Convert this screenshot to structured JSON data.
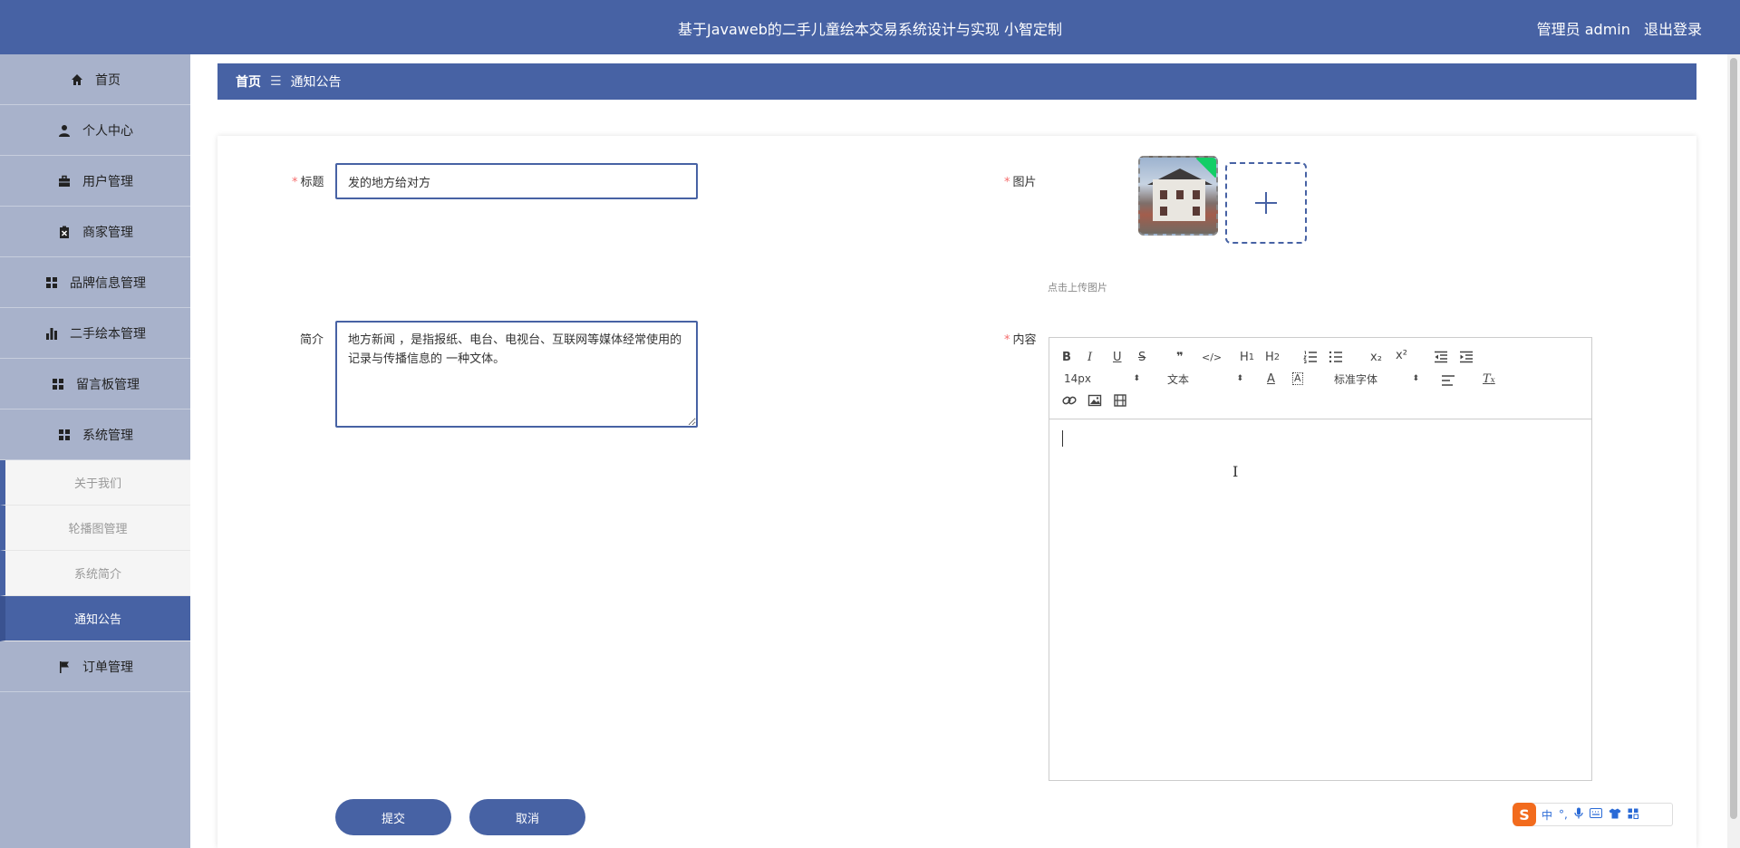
{
  "header": {
    "title": "基于Javaweb的二手儿童绘本交易系统设计与实现 小智定制",
    "user": "管理员 admin",
    "logout": "退出登录"
  },
  "sidebar": {
    "items": [
      {
        "label": "首页",
        "icon": "home-icon"
      },
      {
        "label": "个人中心",
        "icon": "person-icon"
      },
      {
        "label": "用户管理",
        "icon": "briefcase-icon"
      },
      {
        "label": "商家管理",
        "icon": "clipboard-icon"
      },
      {
        "label": "品牌信息管理",
        "icon": "grid-icon"
      },
      {
        "label": "二手绘本管理",
        "icon": "bar-chart-icon"
      },
      {
        "label": "留言板管理",
        "icon": "grid-icon"
      },
      {
        "label": "系统管理",
        "icon": "grid-icon"
      }
    ],
    "submenu": [
      "关于我们",
      "轮播图管理",
      "系统简介",
      "通知公告"
    ],
    "active_sub": "通知公告",
    "last_item": {
      "label": "订单管理",
      "icon": "flag-icon"
    }
  },
  "breadcrumb": {
    "home": "首页",
    "separator": "☰",
    "current": "通知公告"
  },
  "form": {
    "title_label": "标题",
    "title_value": "发的地方给对方",
    "image_label": "图片",
    "upload_tip": "点击上传图片",
    "intro_label": "简介",
    "intro_value": "地方新闻 ，是指报纸、电台、电视台、互联网等媒体经常使用的记录与传播信息的 一种文体。",
    "content_label": "内容",
    "required_mark": "*"
  },
  "editor": {
    "toolbar": {
      "bold": "B",
      "italic": "I",
      "underline": "U",
      "strike": "S",
      "blockquote": "❞",
      "code": "</>",
      "h1": "H1",
      "h2": "H2",
      "ordered_list": "ol",
      "bullet_list": "ul",
      "subscript": "x₂",
      "superscript": "x²",
      "outdent": "outdent",
      "indent": "indent",
      "size": "14px",
      "header": "文本",
      "font": "标准字体",
      "color": "A",
      "background": "A",
      "align": "align",
      "clean": "Tx"
    }
  },
  "buttons": {
    "submit": "提交",
    "cancel": "取消"
  },
  "ime": {
    "logo": "S",
    "lang": "中",
    "punct": "°,"
  },
  "colors": {
    "primary": "#4762a4",
    "sidebar": "#a8b2cb",
    "required": "#f56c6c",
    "success": "#13ce66"
  }
}
